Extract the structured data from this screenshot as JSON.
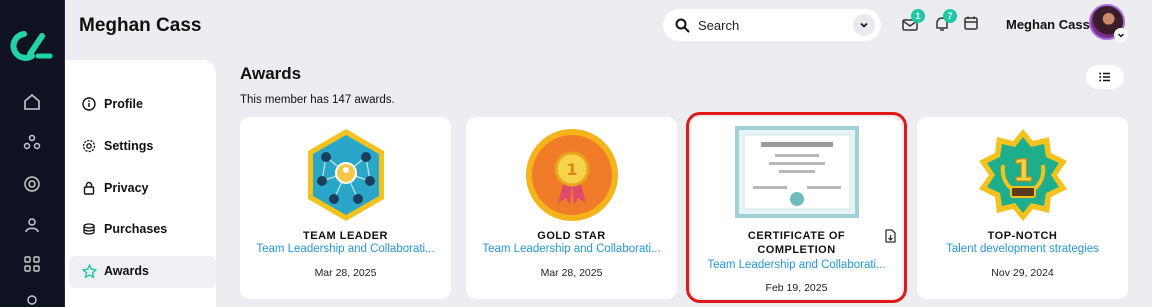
{
  "header": {
    "title": "Meghan Cass",
    "search_placeholder": "Search",
    "messages_badge": "1",
    "notifications_badge": "7",
    "user_name": "Meghan Cass"
  },
  "sidebar": {
    "items": [
      {
        "label": "Profile",
        "icon": "info-icon"
      },
      {
        "label": "Settings",
        "icon": "gear-icon"
      },
      {
        "label": "Privacy",
        "icon": "lock-icon"
      },
      {
        "label": "Purchases",
        "icon": "coins-icon"
      },
      {
        "label": "Awards",
        "icon": "star-icon",
        "active": true
      }
    ]
  },
  "main": {
    "title": "Awards",
    "subtitle": "This member has 147 awards."
  },
  "awards": [
    {
      "title": "TEAM LEADER",
      "subtitle": "Team Leadership and Collaborati...",
      "date": "Mar 28, 2025"
    },
    {
      "title": "GOLD STAR",
      "subtitle": "Team Leadership and Collaborati...",
      "date": "Mar 28, 2025"
    },
    {
      "title": "CERTIFICATE OF COMPLETION",
      "subtitle": "Team Leadership and Collaborati...",
      "date": "Feb 19, 2025"
    },
    {
      "title": "TOP-NOTCH",
      "subtitle": "Talent development strategies",
      "date": "Nov 29, 2024"
    }
  ],
  "colors": {
    "accent": "#1ec9a4",
    "link": "#2596d8",
    "highlight": "#e01818"
  }
}
